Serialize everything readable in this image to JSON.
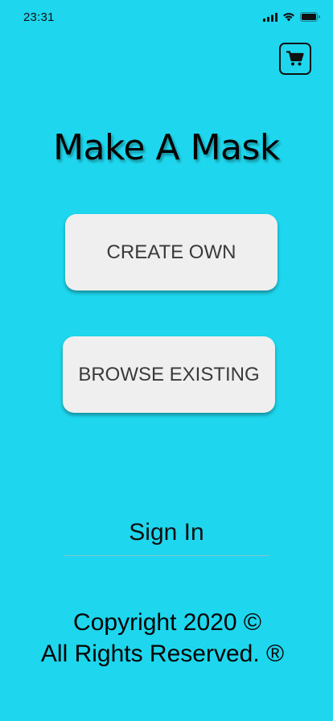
{
  "status_bar": {
    "time": "23:31",
    "icons": [
      "signal-icon",
      "wifi-icon",
      "battery-icon"
    ]
  },
  "header": {
    "cart_icon": "cart-icon"
  },
  "main": {
    "title": "Make A Mask",
    "create_label": "CREATE OWN",
    "browse_label": "BROWSE EXISTING"
  },
  "auth": {
    "signin_label": "Sign In"
  },
  "footer": {
    "line1": "Copyright 2020 ©",
    "line2": "All Rights Reserved. ®"
  },
  "colors": {
    "background": "#1ed7ee",
    "button": "#efefef",
    "button_text": "#3a3a3a"
  }
}
